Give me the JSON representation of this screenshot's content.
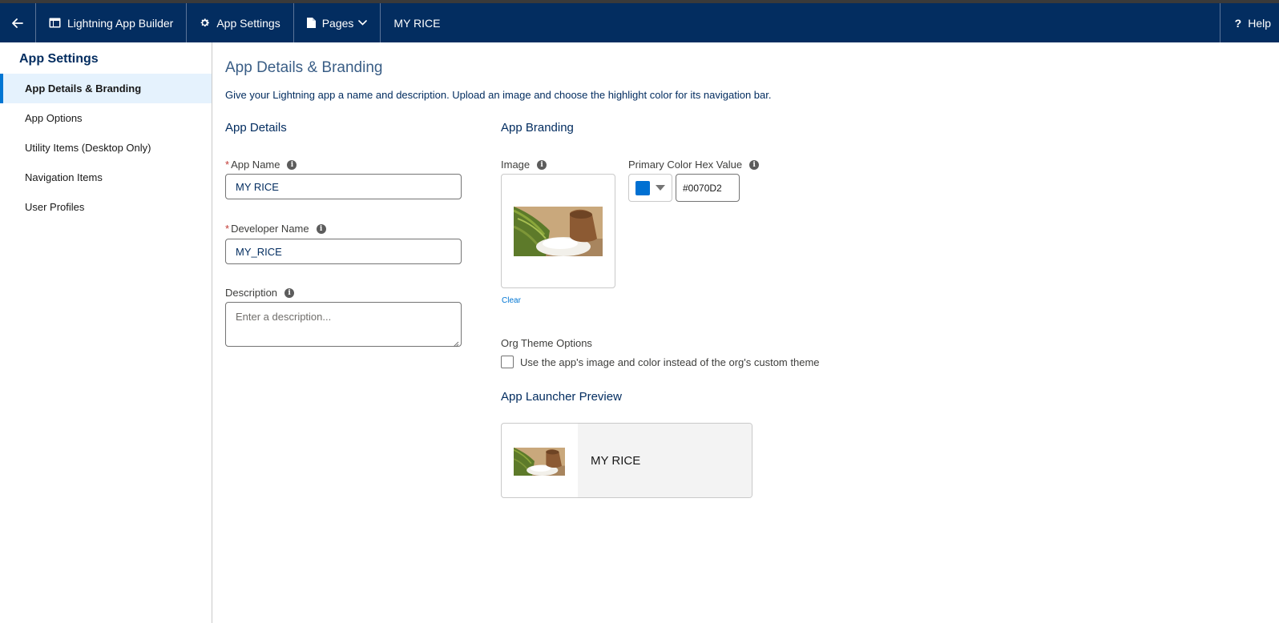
{
  "header": {
    "back_icon": "arrow-left-icon",
    "app_builder_label": "Lightning App Builder",
    "app_settings_label": "App Settings",
    "pages_label": "Pages",
    "app_name": "MY RICE",
    "help_label": "Help",
    "bg_color": "#032d60"
  },
  "sidebar": {
    "title": "App Settings",
    "items": [
      {
        "label": "App Details & Branding",
        "active": true
      },
      {
        "label": "App Options"
      },
      {
        "label": "Utility Items (Desktop Only)"
      },
      {
        "label": "Navigation Items"
      },
      {
        "label": "User Profiles"
      }
    ]
  },
  "main": {
    "title": "App Details & Branding",
    "description": "Give your Lightning app a name and description. Upload an image and choose the highlight color for its navigation bar.",
    "app_details": {
      "section_title": "App Details",
      "app_name_label": "App Name",
      "app_name_value": "MY RICE",
      "developer_name_label": "Developer Name",
      "developer_name_value": "MY_RICE",
      "description_label": "Description",
      "description_placeholder": "Enter a description...",
      "required_marker": "*"
    },
    "app_branding": {
      "section_title": "App Branding",
      "image_label": "Image",
      "clear_label": "Clear",
      "primary_color_label": "Primary Color Hex Value",
      "primary_color_value": "#0070D2",
      "org_theme_title": "Org Theme Options",
      "org_theme_checkbox_label": "Use the app's image and color instead of the org's custom theme",
      "org_theme_checked": false,
      "launcher_title": "App Launcher Preview",
      "launcher_app_name": "MY RICE"
    }
  }
}
